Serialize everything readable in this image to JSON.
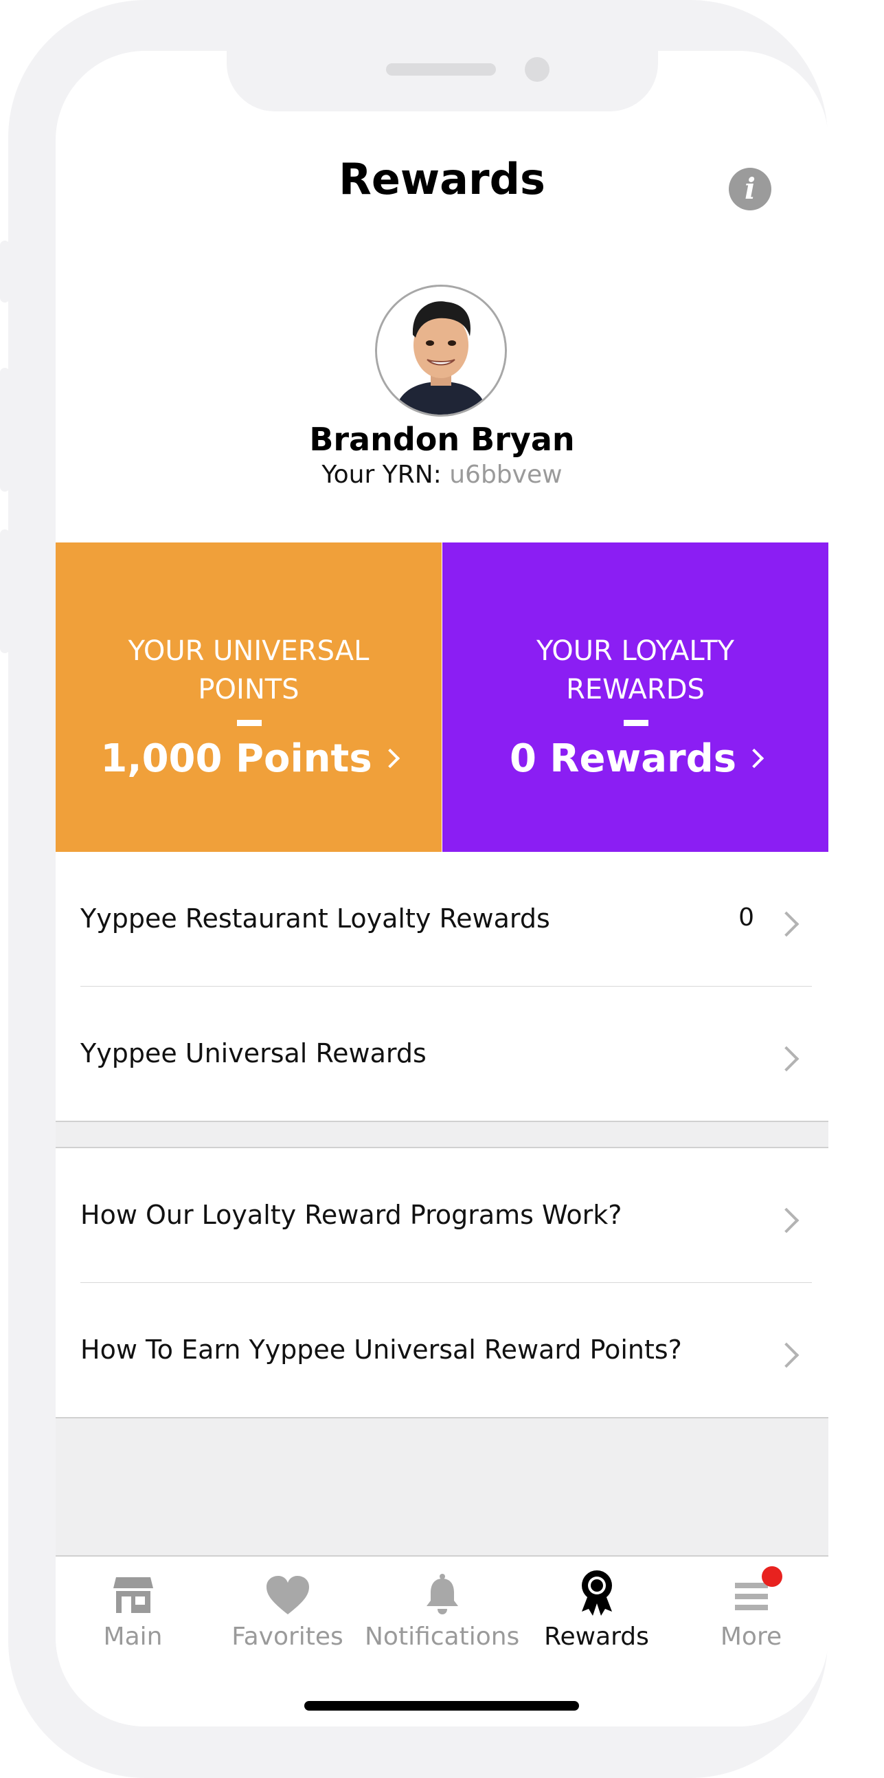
{
  "header": {
    "title": "Rewards",
    "info_icon": "info-icon"
  },
  "profile": {
    "name": "Brandon Bryan",
    "yrn_label": "Your YRN:",
    "yrn_value": "u6bbvew"
  },
  "tiles": {
    "universal": {
      "caption": "YOUR UNIVERSAL POINTS",
      "value": "1,000 Points",
      "color": "#f0a03a"
    },
    "loyalty": {
      "caption": "YOUR LOYALTY REWARDS",
      "value": "0 Rewards",
      "color": "#8b1ef3"
    }
  },
  "rewards_list": [
    {
      "label": "Yyppee Restaurant Loyalty Rewards",
      "count": "0"
    },
    {
      "label": "Yyppee Universal Rewards",
      "count": ""
    }
  ],
  "help_list": [
    {
      "label": "How Our Loyalty Reward Programs Work?"
    },
    {
      "label": "How To Earn Yyppee Universal Reward Points?"
    }
  ],
  "tabbar": {
    "tabs": [
      {
        "label": "Main",
        "icon": "store-icon"
      },
      {
        "label": "Favorites",
        "icon": "heart-icon"
      },
      {
        "label": "Notifications",
        "icon": "bell-icon"
      },
      {
        "label": "Rewards",
        "icon": "award-ribbon-icon",
        "active": true
      },
      {
        "label": "More",
        "icon": "menu-icon",
        "badge": true
      }
    ]
  },
  "colors": {
    "badge": "#e8221f",
    "inactive_tab": "#9a9a9a"
  }
}
